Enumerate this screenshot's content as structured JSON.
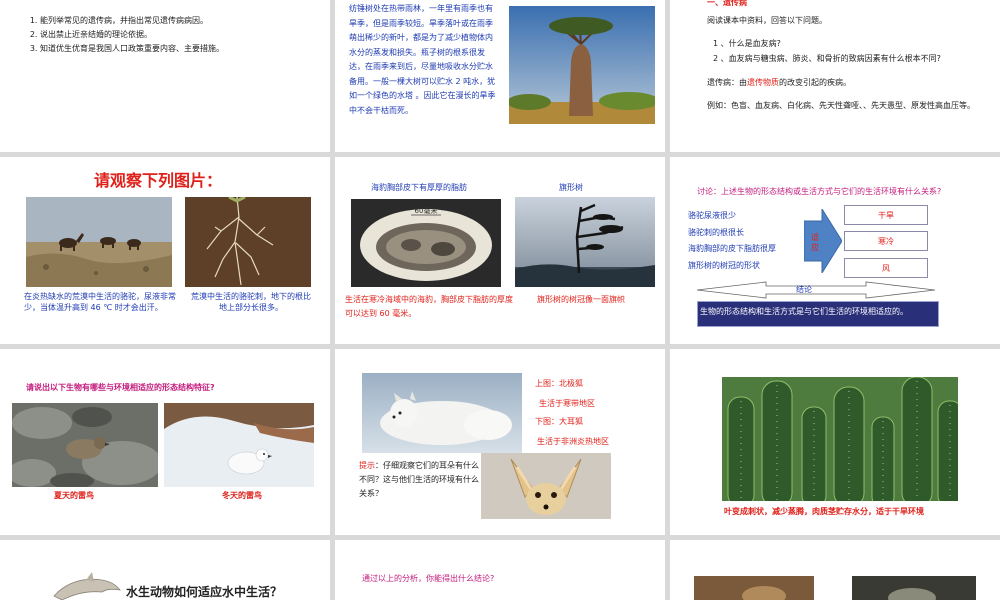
{
  "s1": {
    "items": [
      "能列举常见的遗传病，并指出常见遗传病病因。",
      "说出禁止近亲结婚的理论依据。",
      "知道优生优育是我国人口政策重要内容、主要措施。"
    ]
  },
  "s2": {
    "text": "纺锤树处在热带雨林，一年里有雨季也有旱季，但是雨季较短。旱季落叶或在雨季萌出稀少的新叶，都是为了减少植物体内水分的蒸发和损失。瓶子树的根系很发达，在雨季来到后，尽量地吸收水分贮水备用。一般一棵大树可以贮水 2 吨水，犹如一个绿色的水塔 。因此它在漫长的旱季中不会干枯而死。"
  },
  "s3": {
    "heading": "一、遗传病",
    "intro": "阅读课本中资料，回答以下问题。",
    "q1": "1 、什么是血友病?",
    "q2": "2 、血友病与糖虫病、肺炎、和骨折的致病因素有什么根本不同?",
    "def_prefix": "遗传病：由",
    "def_key": "遗传物质",
    "def_suffix": "的改变引起的疾病。",
    "examples": "例如：色盲、血友病、白化病、先天性聋哑、、先天愚型、原发性高血压等。"
  },
  "s4": {
    "title": "请观察下列图片：",
    "cap1": "在炎热缺水的荒漠中生活的骆驼，尿液非常少，当体温升高到 46 ℃ 时才会出汗。",
    "cap2": "荒漠中生活的骆驼刺，地下的根比地上部分长很多。"
  },
  "s5": {
    "label1": "海豹胸部皮下有厚厚的脂肪",
    "label2": "旗形树",
    "photo_tag": "60毫米",
    "cap1": "生活在寒冷海域中的海豹，胸部皮下脂肪的厚度可以达到 60 毫米。",
    "cap2": "旗形树的树冠像一面旗帜"
  },
  "s6": {
    "question": "讨论：上述生物的形态结构或生活方式与它们的生活环境有什么关系?",
    "left": [
      "骆驼尿液很少",
      "骆驼刺的根很长",
      "海豹胸部的皮下脂肪很厚",
      "旗形树的树冠的形状"
    ],
    "arrow": "适应",
    "right": [
      "干旱",
      "寒冷",
      "风"
    ],
    "conclusion_label": "结论",
    "conclusion": "生物的形态结构和生活方式是与它们生活的环境相适应的。"
  },
  "s7": {
    "question": "请说出以下生物有哪些与环境相适应的形态结构特征?",
    "cap1": "夏天的雷鸟",
    "cap2": "冬天的雷鸟"
  },
  "s8": {
    "l1": "上图：北极狐",
    "l2": "生活于寒带地区",
    "l3": "下图：大耳狐",
    "l4": "生活于非洲炎热地区",
    "hint_label": "提示",
    "hint": "：仔细观察它们的耳朵有什么不同？这与他们生活的环境有什么关系？"
  },
  "s9": {
    "caption": "叶变成刺状，减少蒸腾，肉质茎贮存水分，适于干旱环境"
  },
  "s10": {
    "title": "水生动物如何适应水中生活？"
  },
  "s11": {
    "text": "通过以上的分析，你能得出什么结论?"
  }
}
